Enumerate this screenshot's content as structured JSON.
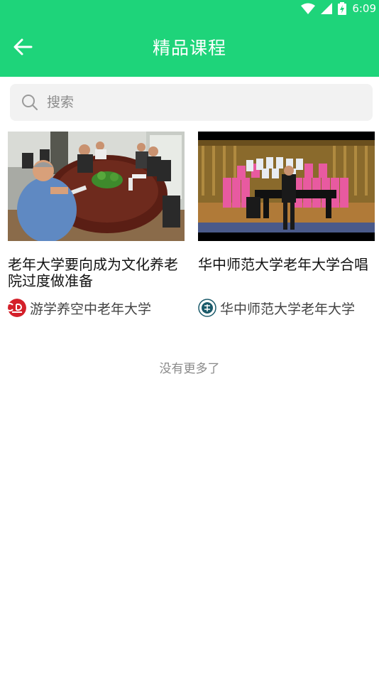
{
  "status_bar": {
    "time": "6:09"
  },
  "header": {
    "title": "精品课程"
  },
  "search": {
    "placeholder": "搜索"
  },
  "courses": [
    {
      "title": "老年大学要向成为文化养老院过度做准备",
      "source": "游学养空中老年大学"
    },
    {
      "title": "华中师范大学老年大学合唱",
      "source": "华中师范大学老年大学"
    }
  ],
  "footer": {
    "no_more": "没有更多了"
  },
  "colors": {
    "brand": "#1ed47a",
    "search_bg": "#f2f2f2"
  }
}
